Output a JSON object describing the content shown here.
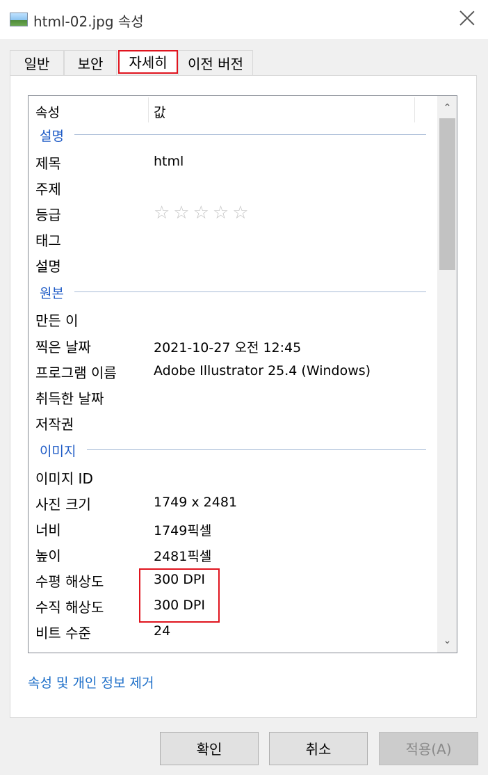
{
  "window": {
    "title": "html-02.jpg 속성",
    "icon": "image-file-icon"
  },
  "tabs": [
    {
      "label": "일반"
    },
    {
      "label": "보안"
    },
    {
      "label": "자세히",
      "active": true
    },
    {
      "label": "이전 버전"
    }
  ],
  "columns": {
    "property": "속성",
    "value": "값"
  },
  "groups": {
    "description": "설명",
    "origin": "원본",
    "image": "이미지"
  },
  "rows": {
    "title": {
      "label": "제목",
      "value": "html"
    },
    "subject": {
      "label": "주제",
      "value": ""
    },
    "rating": {
      "label": "등급",
      "stars": "☆☆☆☆☆",
      "value": 0,
      "max": 5
    },
    "tags": {
      "label": "태그",
      "value": ""
    },
    "comments": {
      "label": "설명",
      "value": ""
    },
    "authors": {
      "label": "만든 이",
      "value": ""
    },
    "date_taken": {
      "label": "찍은 날짜",
      "value": "2021-10-27 오전 12:45"
    },
    "program_name": {
      "label": "프로그램 이름",
      "value": "Adobe Illustrator 25.4 (Windows)"
    },
    "date_acquired": {
      "label": "취득한 날짜",
      "value": ""
    },
    "copyright": {
      "label": "저작권",
      "value": ""
    },
    "image_id": {
      "label": "이미지 ID",
      "value": ""
    },
    "dimensions": {
      "label": "사진 크기",
      "value": "1749 x 2481"
    },
    "width": {
      "label": "너비",
      "value": "1749픽셀"
    },
    "height": {
      "label": "높이",
      "value": "2481픽셀"
    },
    "h_resolution": {
      "label": "수평 해상도",
      "value": "300 DPI"
    },
    "v_resolution": {
      "label": "수직 해상도",
      "value": "300 DPI"
    },
    "bit_depth": {
      "label": "비트 수준",
      "value": "24"
    }
  },
  "link": "속성 및 개인 정보 제거",
  "buttons": {
    "ok": "확인",
    "cancel": "취소",
    "apply": "적용(A)"
  },
  "colors": {
    "highlight": "#e0141e",
    "group_text": "#1e5bc6",
    "link": "#1c6ec8"
  }
}
